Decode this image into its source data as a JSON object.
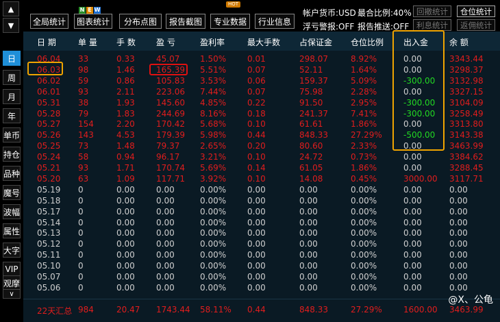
{
  "nav": {
    "up": "▲",
    "down": "▼"
  },
  "toolbar": {
    "overall": "全局统计",
    "report_stats": "图表统计",
    "distribution": "分布点图",
    "screenshot": "报告截图",
    "pro_data": "专业数据",
    "industry": "行业信息",
    "badge_new": [
      "N",
      "E",
      "W"
    ],
    "badge_hot": "HOT"
  },
  "info": {
    "currency": "帐户货币:USD",
    "max_ratio": "最合比例:40%",
    "float_alert": "浮亏警报:OFF",
    "report_push": "报告推送:OFF"
  },
  "right_buttons": {
    "drawdown": "回撤统计",
    "position": "仓位统计",
    "interest": "利息统计",
    "rebate": "返佣统计"
  },
  "side_tabs": [
    "日",
    "周",
    "月",
    "年",
    "单币",
    "持仓",
    "品种",
    "魔号",
    "波幅",
    "属性",
    "大字",
    "VIP",
    "观摩"
  ],
  "side_more": "∨",
  "columns": [
    "日 期",
    "单 量",
    "手 数",
    "盈 亏",
    "盈利率",
    "最大手数",
    "占保证金",
    "仓位比例",
    "出入金",
    "余 额"
  ],
  "rows": [
    [
      "06.04",
      "33",
      "0.33",
      "45.07",
      "1.50%",
      "0.01",
      "298.07",
      "8.92%",
      "0.00",
      "3343.44"
    ],
    [
      "06.03",
      "98",
      "1.46",
      "165.39",
      "5.51%",
      "0.07",
      "52.11",
      "1.64%",
      "0.00",
      "3298.37"
    ],
    [
      "06.02",
      "59",
      "0.86",
      "105.83",
      "3.53%",
      "0.06",
      "159.37",
      "5.09%",
      "-300.00",
      "3132.98"
    ],
    [
      "06.01",
      "93",
      "2.11",
      "223.06",
      "7.44%",
      "0.07",
      "75.98",
      "2.28%",
      "0.00",
      "3327.15"
    ],
    [
      "05.31",
      "38",
      "1.93",
      "145.60",
      "4.85%",
      "0.22",
      "91.50",
      "2.95%",
      "-300.00",
      "3104.09"
    ],
    [
      "05.28",
      "79",
      "1.83",
      "244.69",
      "8.16%",
      "0.18",
      "241.37",
      "7.41%",
      "-300.00",
      "3258.49"
    ],
    [
      "05.27",
      "154",
      "2.20",
      "170.42",
      "5.68%",
      "0.10",
      "61.61",
      "1.86%",
      "0.00",
      "3313.80"
    ],
    [
      "05.26",
      "143",
      "4.53",
      "179.39",
      "5.98%",
      "0.44",
      "848.33",
      "27.29%",
      "-500.00",
      "3143.38"
    ],
    [
      "05.25",
      "73",
      "1.48",
      "79.37",
      "2.65%",
      "0.20",
      "80.60",
      "2.33%",
      "0.00",
      "3463.99"
    ],
    [
      "05.24",
      "58",
      "0.94",
      "96.17",
      "3.21%",
      "0.10",
      "24.72",
      "0.73%",
      "0.00",
      "3384.62"
    ],
    [
      "05.21",
      "93",
      "1.71",
      "170.74",
      "5.69%",
      "0.14",
      "61.05",
      "1.86%",
      "0.00",
      "3288.45"
    ],
    [
      "05.20",
      "63",
      "1.09",
      "117.71",
      "3.92%",
      "0.10",
      "14.08",
      "0.45%",
      "3000.00",
      "3117.71"
    ],
    [
      "05.19",
      "0",
      "0.00",
      "0.00",
      "0.00%",
      "0.00",
      "0.00",
      "0.00%",
      "0.00",
      "0.00"
    ],
    [
      "05.18",
      "0",
      "0.00",
      "0.00",
      "0.00%",
      "0.00",
      "0.00",
      "0.00%",
      "0.00",
      "0.00"
    ],
    [
      "05.17",
      "0",
      "0.00",
      "0.00",
      "0.00%",
      "0.00",
      "0.00",
      "0.00%",
      "0.00",
      "0.00"
    ],
    [
      "05.14",
      "0",
      "0.00",
      "0.00",
      "0.00%",
      "0.00",
      "0.00",
      "0.00%",
      "0.00",
      "0.00"
    ],
    [
      "05.13",
      "0",
      "0.00",
      "0.00",
      "0.00%",
      "0.00",
      "0.00",
      "0.00%",
      "0.00",
      "0.00"
    ],
    [
      "05.12",
      "0",
      "0.00",
      "0.00",
      "0.00%",
      "0.00",
      "0.00",
      "0.00%",
      "0.00",
      "0.00"
    ],
    [
      "05.11",
      "0",
      "0.00",
      "0.00",
      "0.00%",
      "0.00",
      "0.00",
      "0.00%",
      "0.00",
      "0.00"
    ],
    [
      "05.10",
      "0",
      "0.00",
      "0.00",
      "0.00%",
      "0.00",
      "0.00",
      "0.00%",
      "0.00",
      "0.00"
    ],
    [
      "05.07",
      "0",
      "0.00",
      "0.00",
      "0.00%",
      "0.00",
      "0.00",
      "0.00%",
      "0.00",
      "0.00"
    ],
    [
      "05.06",
      "0",
      "0.00",
      "0.00",
      "0.00%",
      "0.00",
      "0.00",
      "0.00%",
      "0.00",
      "0.00"
    ]
  ],
  "summary": [
    "22天汇总",
    "984",
    "20.47",
    "1743.44",
    "58.11%",
    "0.44",
    "848.33",
    "27.29%",
    "1600.00",
    "3463.99"
  ],
  "watermark": "@X、公龟",
  "colors": {
    "profit": "#e11d1d",
    "zero": "#d0d0d0",
    "withdraw": "#22d822",
    "highlight": "#f0a400",
    "active_tab": "#1f8fd8"
  }
}
